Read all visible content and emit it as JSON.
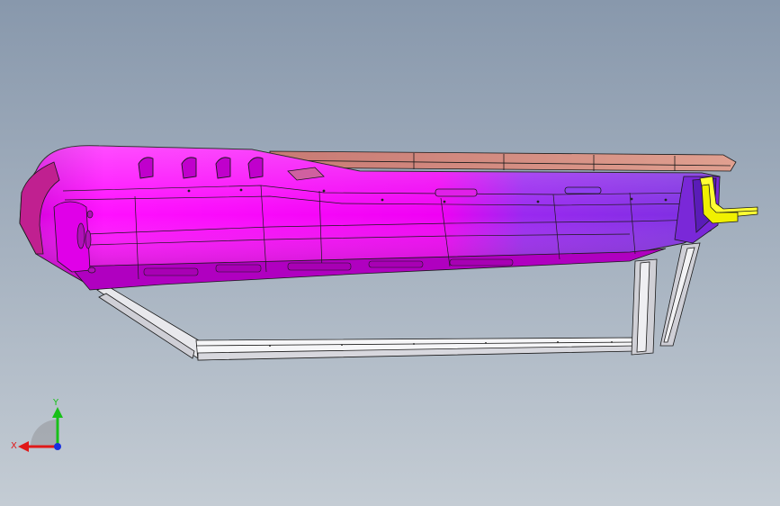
{
  "viewport": {
    "background_top": "#8898ac",
    "background_bottom": "#c4ccd4"
  },
  "model": {
    "primary_color": "#ff00ff",
    "secondary_color": "#8a2be2",
    "flange_color": "#d08a7c",
    "frame_color": "#f2f2f2",
    "bracket_color": "#ffff33",
    "edge_color": "#1a1a1a"
  },
  "triad": {
    "x_label": "X",
    "y_label": "Y",
    "x_color": "#e01818",
    "y_color": "#18c018",
    "z_color": "#1830e0"
  }
}
